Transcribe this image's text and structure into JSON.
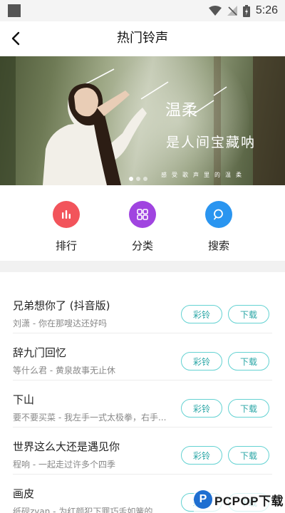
{
  "status_bar": {
    "time": "5:26"
  },
  "header": {
    "title": "热门铃声"
  },
  "banner": {
    "title_line1": "温柔",
    "title_line2": "是人间宝藏呐",
    "caption": "感受歌声里的温柔",
    "dots": 3,
    "active_dot": 0
  },
  "categories": [
    {
      "label": "排行",
      "icon": "bar-chart-icon",
      "color": "#f2545b"
    },
    {
      "label": "分类",
      "icon": "grid-icon",
      "color": "#a044e0"
    },
    {
      "label": "搜索",
      "icon": "search-icon",
      "color": "#2a95f0"
    }
  ],
  "colors": {
    "accent": "#64d2d2",
    "accent_text": "#2aa6a6"
  },
  "songs": [
    {
      "title": "兄弟想你了 (抖音版)",
      "subtitle": "刘潇 - 你在那嗖达还好吗",
      "ring_label": "彩铃",
      "download_label": "下载"
    },
    {
      "title": "辞九门回忆",
      "subtitle": "等什么君 - 黄泉故事无止休",
      "ring_label": "彩铃",
      "download_label": "下载"
    },
    {
      "title": "下山",
      "subtitle": "要不要买菜 - 我左手一式太极拳，右手...",
      "ring_label": "彩铃",
      "download_label": "下载"
    },
    {
      "title": "世界这么大还是遇见你",
      "subtitle": "程响 - 一起走过许多个四季",
      "ring_label": "彩铃",
      "download_label": "下载"
    },
    {
      "title": "画皮",
      "subtitle": "纸砚zyan - 为红颜犯下罪巧舌如簧的...",
      "ring_label": "彩铃",
      "download_label": "下载"
    }
  ],
  "watermark": {
    "text": "PCPOP下载",
    "logo_letter": "P"
  }
}
